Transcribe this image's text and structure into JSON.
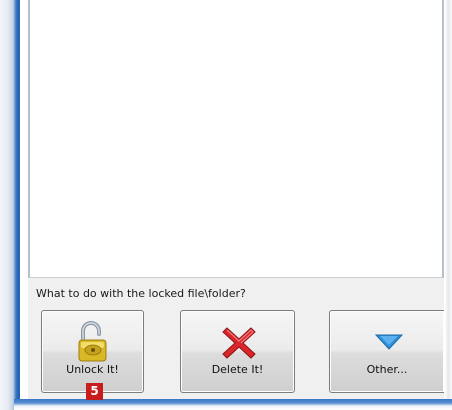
{
  "dialog": {
    "prompt": "What to do with the locked file\\folder?"
  },
  "actions": {
    "unlock_label": "Unlock It!",
    "delete_label": "Delete It!",
    "other_label": "Other..."
  },
  "annotation": {
    "step_number": "5"
  },
  "icons": {
    "unlock": "open-padlock-icon",
    "delete": "red-x-icon",
    "other": "triangle-down-icon"
  },
  "colors": {
    "badge": "#c81d1d",
    "delete_icon": "#d8262b",
    "other_icon": "#2f8fd8",
    "frame_accent": "#1f5fb2"
  }
}
